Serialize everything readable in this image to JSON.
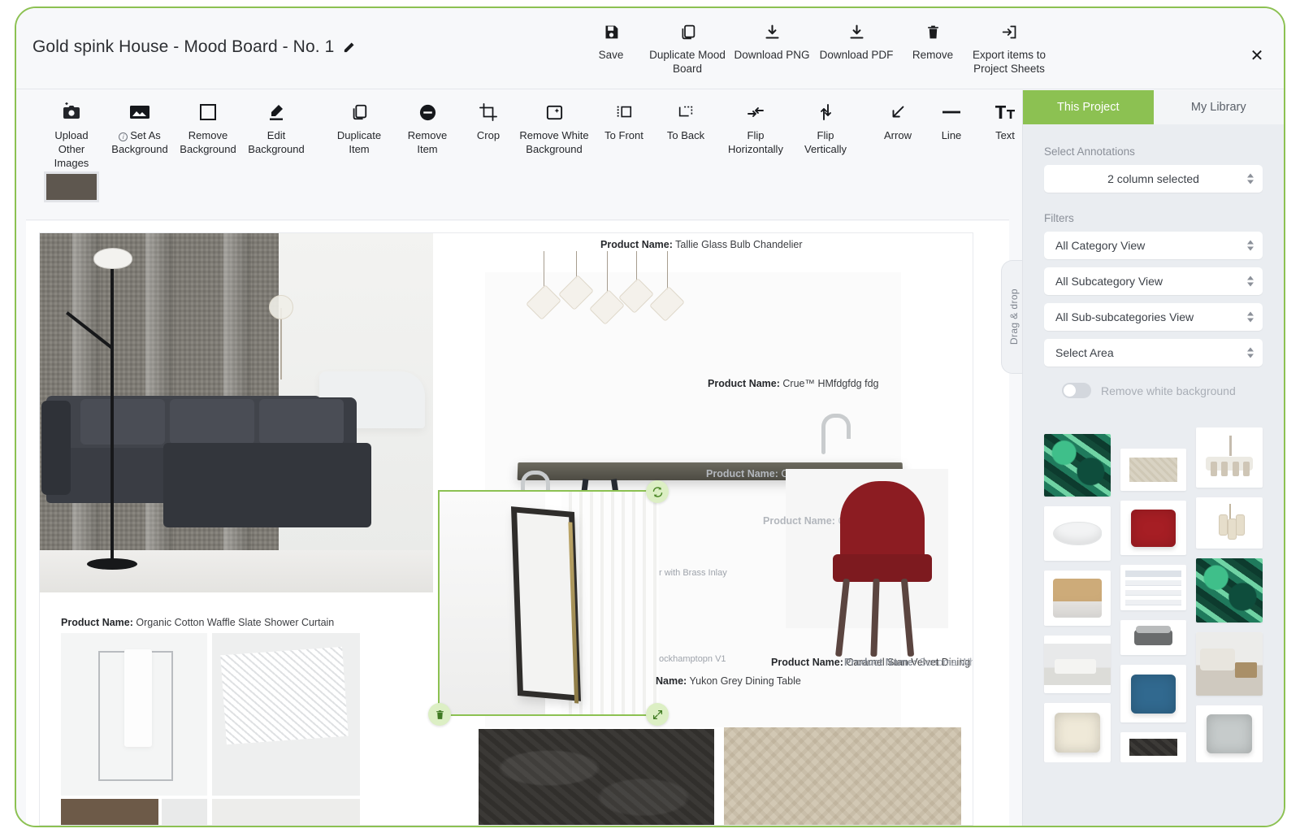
{
  "header": {
    "board_title": "Gold spink House - Mood Board - No. 1",
    "edit_icon": "pencil-icon",
    "close_icon": "close-icon",
    "actions": [
      {
        "label": "Save",
        "icon": "save-icon"
      },
      {
        "label": "Duplicate Mood Board",
        "icon": "duplicate-icon"
      },
      {
        "label": "Download PNG",
        "icon": "download-icon"
      },
      {
        "label": "Download PDF",
        "icon": "download-icon"
      },
      {
        "label": "Remove",
        "icon": "trash-icon"
      },
      {
        "label": "Export items to Project Sheets",
        "icon": "export-icon"
      }
    ]
  },
  "toolbar": {
    "tools": [
      {
        "label": "Upload Other Images",
        "icon": "camera-plus-icon"
      },
      {
        "label": "Set As Background",
        "icon": "image-icon",
        "info": true
      },
      {
        "label": "Remove Background",
        "icon": "square-icon"
      },
      {
        "label": "Edit Background",
        "icon": "pencil-edit-icon"
      },
      {
        "label": "Duplicate Item",
        "icon": "duplicate-icon"
      },
      {
        "label": "Remove Item",
        "icon": "minus-circle-icon"
      },
      {
        "label": "Crop",
        "icon": "crop-icon"
      },
      {
        "label": "Remove White Background",
        "icon": "magic-image-icon"
      },
      {
        "label": "To Front",
        "icon": "to-front-icon"
      },
      {
        "label": "To Back",
        "icon": "to-back-icon"
      },
      {
        "label": "Flip Horizontally",
        "icon": "flip-horizontal-icon"
      },
      {
        "label": "Flip Vertically",
        "icon": "flip-vertical-icon"
      },
      {
        "label": "Arrow",
        "icon": "arrow-icon"
      },
      {
        "label": "Line",
        "icon": "line-icon"
      },
      {
        "label": "Text",
        "icon": "text-icon"
      }
    ],
    "swatch_color": "#5e574f"
  },
  "canvas": {
    "labels": [
      {
        "bold": "Product Name:",
        "text": " Tallie Glass Bulb Chandelier"
      },
      {
        "bold": "Product Name:",
        "text": " Crue™ HMfdgfdg fdg"
      },
      {
        "bold": "Product Name:",
        "text": " Crue™ HMfdgfdg fdg"
      },
      {
        "bold": "Product Name:",
        "text": " Crue™"
      },
      {
        "bold": "Product Name:",
        "text": " Organic Cotton Waffle Slate Shower Curtain"
      },
      {
        "bold": "",
        "text": "r with Brass Inlay"
      },
      {
        "bold": "",
        "text": "ockhamptopn V1"
      },
      {
        "bold": "Name:",
        "text": " Yukon Grey Dining Table"
      },
      {
        "bold": "Product Name:",
        "text": " Caramel Stan Velvet Dining"
      },
      {
        "bold": "Product Name:",
        "text": " Sonoma White Dining"
      }
    ],
    "selection": {
      "rotate_icon": "rotate-icon",
      "delete_icon": "trash-icon",
      "resize_icon": "resize-icon"
    },
    "drag_drop_tab": "Drag & drop"
  },
  "sidebar": {
    "tabs": [
      {
        "label": "This Project",
        "active": true
      },
      {
        "label": "My Library",
        "active": false
      }
    ],
    "annotations_label": "Select Annotations",
    "annotations_value": "2 column selected",
    "filters_label": "Filters",
    "filters": [
      "All Category View",
      "All Subcategory View",
      "All Sub-subcategories View",
      "Select Area"
    ],
    "remove_white_bg_label": "Remove white background",
    "remove_white_bg_on": false,
    "thumbnails": [
      {
        "name": "green-abstract-art",
        "kind": "green"
      },
      {
        "name": "beige-fabric-swatch",
        "kind": "fabric"
      },
      {
        "name": "drum-chandelier",
        "kind": "chandelier"
      },
      {
        "name": "freestanding-bathtub",
        "kind": "tub"
      },
      {
        "name": "red-velvet-pillow",
        "kind": "pillow-red"
      },
      {
        "name": "glass-pendant-light",
        "kind": "pendant"
      },
      {
        "name": "woven-lounge-chair",
        "kind": "chair"
      },
      {
        "name": "spreadsheet-screenshot",
        "kind": "table"
      },
      {
        "name": "green-abstract-art-2",
        "kind": "green"
      },
      {
        "name": "grey-interior-render",
        "kind": "room"
      },
      {
        "name": "grey-sofa",
        "kind": "sofa"
      },
      {
        "name": "living-room-scene",
        "kind": "living"
      },
      {
        "name": "cream-pillow",
        "kind": "pillow-cream"
      },
      {
        "name": "blue-velvet-pillow",
        "kind": "pillow-blue"
      },
      {
        "name": "grey-pillow",
        "kind": "pillow-grey"
      },
      {
        "name": "dark-textured-rug",
        "kind": "dark"
      }
    ]
  },
  "colors": {
    "accent_green": "#8cc152",
    "panel_bg": "#eaedf1",
    "canvas_bg": "#ffffff"
  }
}
